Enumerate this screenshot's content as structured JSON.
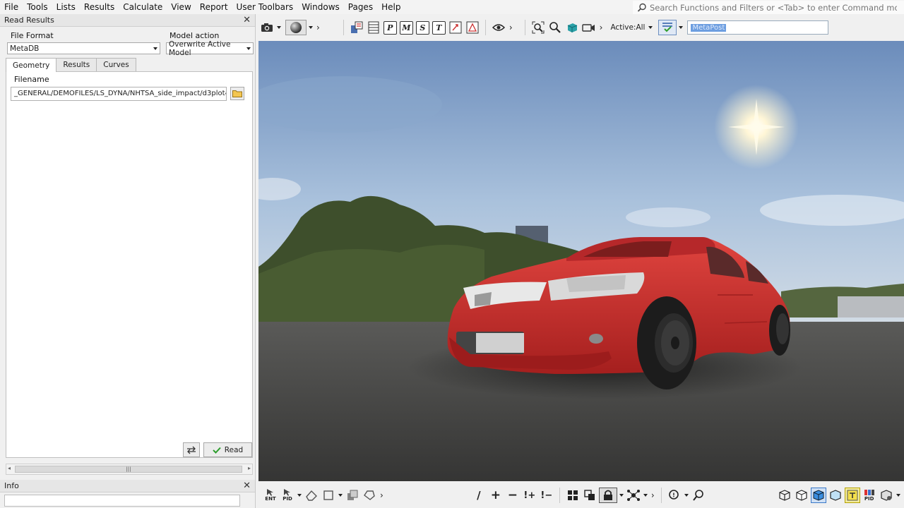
{
  "menubar": {
    "items": [
      "File",
      "Tools",
      "Lists",
      "Results",
      "Calculate",
      "View",
      "Report",
      "User Toolbars",
      "Windows",
      "Pages",
      "Help"
    ]
  },
  "search": {
    "placeholder": "Search Functions and Filters or <Tab> to enter Command mode"
  },
  "read_results": {
    "title": "Read Results",
    "file_format_label": "File Format",
    "file_format_value": "MetaDB",
    "model_action_label": "Model action",
    "model_action_value": "Overwrite Active Model",
    "tabs": [
      "Geometry",
      "Results",
      "Curves"
    ],
    "active_tab": "Geometry",
    "filename_label": "Filename",
    "filename_value": "_GENERAL/DEMOFILES/LS_DYNA/NHTSA_side_impact/d3plot",
    "read_label": "Read"
  },
  "info_panel": {
    "title": "Info"
  },
  "toolbar": {
    "active_label": "Active:All",
    "metapost_value": "MetaPost",
    "letter_buttons": [
      "P",
      "M",
      "S",
      "T"
    ]
  },
  "bottom_toolbar": {
    "ent_label": "ENT",
    "pid_label": "PID",
    "pid_small_label": "PID"
  },
  "colors": {
    "car_red": "#d8312f",
    "sky_top": "#6e8fbd",
    "ground": "#3f3f3f",
    "accent_blue": "#6d9ee0"
  }
}
